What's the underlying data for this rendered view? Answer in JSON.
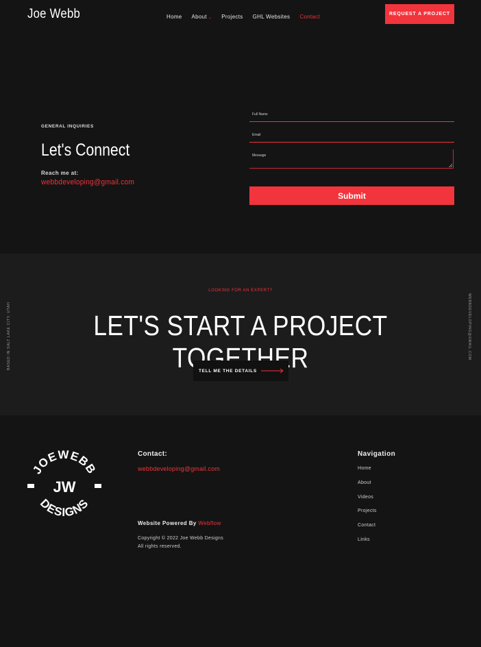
{
  "header": {
    "brand": "Joe Webb",
    "nav": [
      {
        "label": "Home"
      },
      {
        "label": "About"
      },
      {
        "label": "Projects"
      },
      {
        "label": "GHL Websites"
      },
      {
        "label": "Contact"
      }
    ],
    "request_button": "REQUEST A PROJECT"
  },
  "contact_section": {
    "eyebrow": "GENERAL INQUIRIES",
    "title": "Let's Connect",
    "reach_label": "Reach me at:",
    "email": "webbdeveloping@gmail.com",
    "form": {
      "full_name_placeholder": "Full Name",
      "email_placeholder": "Email",
      "message_placeholder": "Message",
      "submit_label": "Submit"
    }
  },
  "project_band": {
    "eyebrow": "LOOKING FOR AN EXPERT?",
    "headline": "LET'S START A PROJECT TOGETHER",
    "button_label": "TELL ME THE DETAILS",
    "side_left": "BASED IN SALT LAKE CITY, UTAH",
    "side_right": "WEBBDEVELOPING@GMAIL.COM"
  },
  "footer": {
    "logo_ring_text": "JOEWEBB DESIGNS",
    "logo_initials": "JW",
    "contact_heading": "Contact:",
    "contact_email": "webbdeveloping@gmail.com",
    "powered_by": "Website Powered By",
    "powered_by_link": "Webflow",
    "copyright_line1": "Copyright © 2022 Joe Webb Designs",
    "copyright_line2": "All rights reserved.",
    "nav_heading": "Navigation",
    "nav": [
      "Home",
      "About",
      "Videos",
      "Projects",
      "Contact",
      "Links"
    ]
  },
  "colors": {
    "accent": "#f2343c",
    "background": "#141414",
    "band": "#1c1c1c"
  }
}
